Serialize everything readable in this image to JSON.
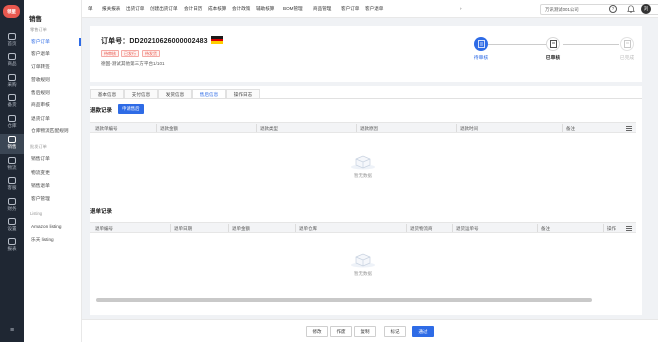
{
  "app": {
    "logo": "领星"
  },
  "leftnav": [
    {
      "label": "首页",
      "icon": "home-icon"
    },
    {
      "label": "商品",
      "icon": "box-icon"
    },
    {
      "label": "采购",
      "icon": "cart-icon"
    },
    {
      "label": "备货",
      "icon": "stock-icon"
    },
    {
      "label": "仓库",
      "icon": "warehouse-icon"
    },
    {
      "label": "销售",
      "icon": "sales-chart-icon"
    },
    {
      "label": "物流",
      "icon": "truck-icon"
    },
    {
      "label": "客服",
      "icon": "headset-icon"
    },
    {
      "label": "财务",
      "icon": "finance-icon"
    },
    {
      "label": "设置",
      "icon": "settings-icon"
    },
    {
      "label": "报表",
      "icon": "report-icon"
    }
  ],
  "submenu": {
    "title": "销售",
    "items": [
      {
        "label": "零售订单",
        "type": "group"
      },
      {
        "label": "客户订单",
        "type": "item",
        "active": true
      },
      {
        "label": "客户退单",
        "type": "item"
      },
      {
        "label": "订单转签",
        "type": "item"
      },
      {
        "label": "营收规则",
        "type": "item"
      },
      {
        "label": "售后规则",
        "type": "item"
      },
      {
        "label": "商品审核",
        "type": "item"
      },
      {
        "label": "退货订单",
        "type": "item"
      },
      {
        "label": "仓库物流匹配规则",
        "type": "item"
      },
      {
        "label": "批发订单",
        "type": "group"
      },
      {
        "label": "销售订单",
        "type": "item"
      },
      {
        "label": "物流变更",
        "type": "item"
      },
      {
        "label": "销售退单",
        "type": "item"
      },
      {
        "label": "客户管理",
        "type": "item"
      },
      {
        "label": "Listing",
        "type": "group"
      },
      {
        "label": "Amazon listing",
        "type": "item"
      },
      {
        "label": "乐天 listing",
        "type": "item"
      }
    ]
  },
  "topnav": {
    "tabs": [
      "单",
      "报关报表",
      "出货订单",
      "创建出货订单",
      "会计日历",
      "成本核算",
      "会计政策",
      "辅助核算",
      "BOM管理",
      "商品管理",
      "客户订单",
      "客户退单"
    ],
    "more": "›",
    "company": "万讯测试001公司",
    "help_icon": "?",
    "bell_icon": "🔔",
    "avatar": "刘"
  },
  "order": {
    "number": "订单号：DD20210626000002483",
    "flag_colors": [
      "#1a1a1a",
      "#dd0000",
      "#ffce00"
    ],
    "badges": [
      "待审核",
      "已发行",
      "待发货"
    ],
    "store": "德国-测试其他第三方平台1/101"
  },
  "steps": [
    {
      "label": "待审核",
      "state": "active"
    },
    {
      "label": "已审核",
      "state": "done"
    },
    {
      "label": "已完成",
      "state": "todo"
    }
  ],
  "detail_tabs": [
    {
      "label": "基本信息",
      "active": false
    },
    {
      "label": "支付信息",
      "active": false
    },
    {
      "label": "发货信息",
      "active": false
    },
    {
      "label": "售后信息",
      "active": true
    },
    {
      "label": "操作日志",
      "active": false
    }
  ],
  "refund_section": {
    "title": "退款记录",
    "apply_button": "申请售后",
    "columns": [
      "退款单编号",
      "退款金额",
      "退款类型",
      "退款原因",
      "退款时间",
      "备注"
    ],
    "empty_text": "暂无数据"
  },
  "return_section": {
    "title": "退单记录",
    "columns": [
      "退单编号",
      "退单日期",
      "退单金额",
      "退单仓库",
      "退货物流商",
      "退货运单号",
      "备注",
      "操作"
    ],
    "empty_text": "暂无数据"
  },
  "footer": {
    "buttons": [
      {
        "label": "修改",
        "primary": false
      },
      {
        "label": "作废",
        "primary": false
      },
      {
        "label": "复制",
        "primary": false
      },
      {
        "label": "标记",
        "primary": false
      },
      {
        "label": "通过",
        "primary": true
      }
    ]
  },
  "colors": {
    "primary": "#2e6be6",
    "sidebar": "#1f2733",
    "danger": "#e8584f"
  }
}
